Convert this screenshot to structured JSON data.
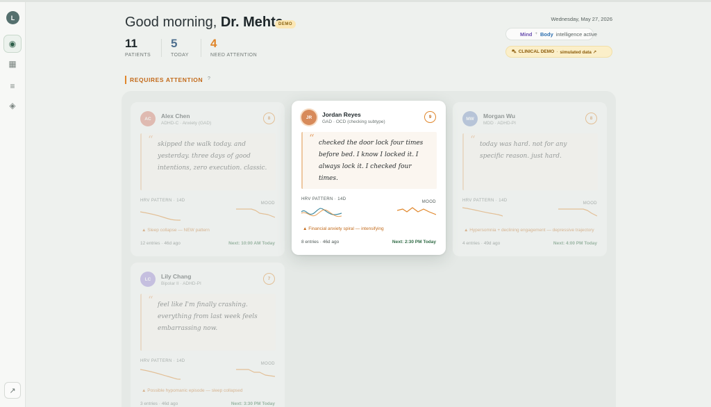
{
  "user": {
    "initial": "L"
  },
  "nav": {
    "items": [
      {
        "name": "dashboard",
        "icon": "◉"
      },
      {
        "name": "calendar",
        "icon": "▦"
      },
      {
        "name": "list",
        "icon": "≡"
      },
      {
        "name": "insights",
        "icon": "◈"
      }
    ],
    "bottom_icon": "↗"
  },
  "header": {
    "greeting_prefix": "Good morning,",
    "doctor_name": "Dr. Mehta",
    "demo_badge": "DEMO",
    "date": "Wednesday, May 27, 2026"
  },
  "stats": [
    {
      "value": "11",
      "label": "PATIENTS",
      "color": "#1d2629"
    },
    {
      "value": "5",
      "label": "TODAY",
      "color": "#4e6f8e"
    },
    {
      "value": "4",
      "label": "NEED ATTENTION",
      "color": "#e0862a"
    }
  ],
  "intelligence_pill": {
    "mind": "Mind",
    "plus": "+",
    "body": "Body",
    "rest": "intelligence active"
  },
  "clinical_demo": {
    "icon": "⛍",
    "label": "CLINICAL DEMO",
    "sep": "·",
    "rest": "simulated data ↗"
  },
  "section": {
    "title": "REQUIRES ATTENTION",
    "help": "?"
  },
  "cards": [
    {
      "initials": "AC",
      "avatar_color": "#d97a6a",
      "name": "Alex Chen",
      "diagnosis": "ADHD-C · Anxiety (GAD)",
      "score": "8",
      "quote_mark": "“",
      "quote": "skipped the walk today. and yesterday. three days of good intentions, zero execution. classic.",
      "hrv_label": "HRV PATTERN · 14D",
      "mood_label": "MOOD",
      "alert": "▲ Sleep collapse — NEW pattern",
      "footer": "12 entries · 46d ago",
      "next": "Next: 10:00 AM Today"
    },
    {
      "initials": "JR",
      "avatar_color": "#d78a5a",
      "name": "Jordan Reyes",
      "diagnosis": "GAD · OCD (checking subtype)",
      "score": "9",
      "quote_mark": "“",
      "quote": "checked the door lock four times before bed. I know I locked it. I always lock it. I checked four times.",
      "hrv_label": "HRV PATTERN · 14D",
      "mood_label": "MOOD",
      "alert": "▲ Financial anxiety spiral — intensifying",
      "footer": "8 entries · 46d ago",
      "next": "Next: 2:30 PM Today"
    },
    {
      "initials": "MW",
      "avatar_color": "#7a93c7",
      "name": "Morgan Wu",
      "diagnosis": "MDD · ADHD-PI",
      "score": "8",
      "quote_mark": "“",
      "quote": "today was hard. not for any specific reason. just hard.",
      "hrv_label": "HRV PATTERN · 14D",
      "mood_label": "MOOD",
      "alert": "▲ Hypersomnia + declining engagement — depressive trajectory",
      "footer": "4 entries · 49d ago",
      "next": "Next: 4:00 PM Today"
    },
    {
      "initials": "LC",
      "avatar_color": "#9a86d6",
      "name": "Lily Chang",
      "diagnosis": "Bipolar II · ADHD-PI",
      "score": "7",
      "quote_mark": "“",
      "quote": "feel like I'm finally crashing. everything from last week feels embarrassing now.",
      "hrv_label": "HRV PATTERN · 14D",
      "mood_label": "MOOD",
      "alert": "▲ Possible hypomanic episode — sleep collapsed",
      "footer": "3 entries · 46d ago",
      "next": "Next: 3:30 PM Today"
    }
  ],
  "colors": {
    "accent": "#e0862a",
    "hrv_line": "#e0862a",
    "hrv_line_alt": "#3f8aa0",
    "next": "#2f6a44"
  }
}
